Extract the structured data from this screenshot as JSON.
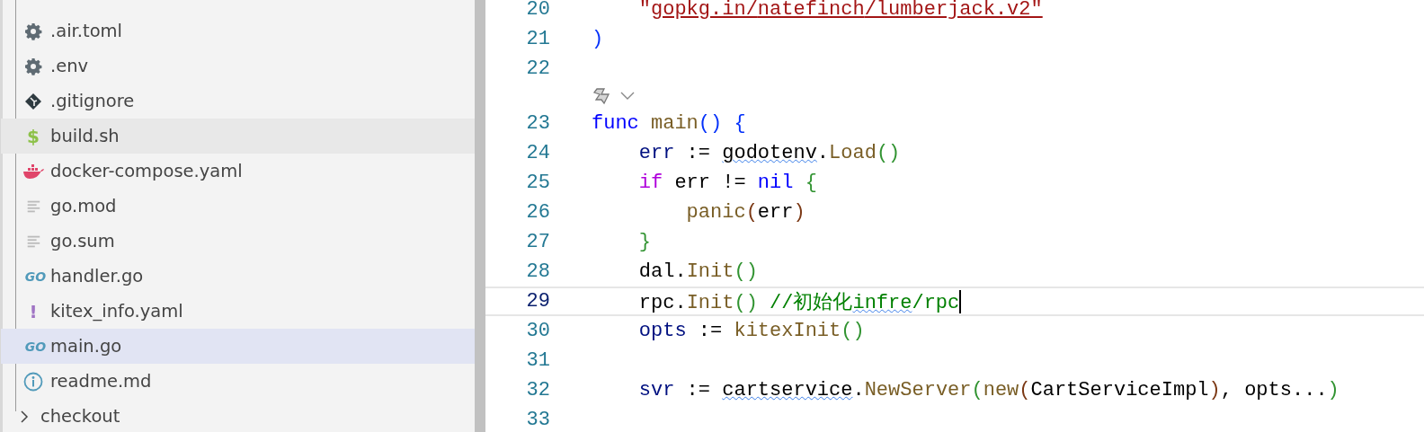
{
  "explorer": {
    "items": [
      {
        "kind": "gear",
        "name": ".air.toml",
        "selected": false,
        "hovered": false
      },
      {
        "kind": "gear",
        "name": ".env",
        "selected": false,
        "hovered": false
      },
      {
        "kind": "git",
        "name": ".gitignore",
        "selected": false,
        "hovered": false
      },
      {
        "kind": "shell",
        "glyph": "$",
        "name": "build.sh",
        "selected": false,
        "hovered": true
      },
      {
        "kind": "docker",
        "name": "docker-compose.yaml",
        "selected": false,
        "hovered": false
      },
      {
        "kind": "text",
        "name": "go.mod",
        "selected": false,
        "hovered": false
      },
      {
        "kind": "text",
        "name": "go.sum",
        "selected": false,
        "hovered": false
      },
      {
        "kind": "go",
        "glyph": "GO",
        "name": "handler.go",
        "selected": false,
        "hovered": false
      },
      {
        "kind": "yaml",
        "glyph": "!",
        "name": "kitex_info.yaml",
        "selected": false,
        "hovered": false
      },
      {
        "kind": "go",
        "glyph": "GO",
        "name": "main.go",
        "selected": true,
        "hovered": false
      },
      {
        "kind": "info",
        "name": "readme.md",
        "selected": false,
        "hovered": false
      },
      {
        "kind": "folder",
        "name": "checkout",
        "expanded": false,
        "selected": false,
        "hovered": false
      }
    ]
  },
  "editor": {
    "lines": [
      {
        "kind": "code",
        "number": "20",
        "current": false,
        "tokens": [
          {
            "text": "    \"",
            "kind": "str"
          },
          {
            "text": "gopkg.in/",
            "kind": "link"
          },
          {
            "text": "natefinch",
            "kind": "link-squiggle"
          },
          {
            "text": "/lumberjack.v2\"",
            "kind": "link"
          }
        ]
      },
      {
        "kind": "code",
        "number": "21",
        "current": false,
        "tokens": [
          {
            "text": ")",
            "kind": "b1"
          }
        ]
      },
      {
        "kind": "code",
        "number": "22",
        "current": false
      },
      {
        "kind": "lens"
      },
      {
        "kind": "code",
        "number": "23",
        "current": false,
        "tokens": [
          {
            "text": "func",
            "kind": "kw"
          },
          {
            "text": " main",
            "kind": "fn"
          },
          {
            "text": "()",
            "kind": "b1"
          },
          {
            "text": " {",
            "kind": "b1"
          }
        ]
      },
      {
        "kind": "code",
        "number": "24",
        "current": false,
        "tokens": [
          {
            "text": "    err",
            "kind": "var"
          },
          {
            "text": " := ",
            "kind": "op"
          },
          {
            "text": "godotenv",
            "kind": "op-squiggle"
          },
          {
            "text": ".",
            "kind": "op"
          },
          {
            "text": "Load",
            "kind": "fn"
          },
          {
            "text": "()",
            "kind": "b2"
          }
        ]
      },
      {
        "kind": "code",
        "number": "25",
        "current": false,
        "tokens": [
          {
            "text": "    if",
            "kind": "ctrl"
          },
          {
            "text": " err != ",
            "kind": "op"
          },
          {
            "text": "nil",
            "kind": "kw"
          },
          {
            "text": " {",
            "kind": "b2"
          }
        ]
      },
      {
        "kind": "code",
        "number": "26",
        "current": false,
        "tokens": [
          {
            "text": "        panic",
            "kind": "fn"
          },
          {
            "text": "(",
            "kind": "b3"
          },
          {
            "text": "err",
            "kind": "op"
          },
          {
            "text": ")",
            "kind": "b3"
          }
        ]
      },
      {
        "kind": "code",
        "number": "27",
        "current": false,
        "tokens": [
          {
            "text": "    }",
            "kind": "b2"
          }
        ]
      },
      {
        "kind": "code",
        "number": "28",
        "current": false,
        "tokens": [
          {
            "text": "    dal.",
            "kind": "op"
          },
          {
            "text": "Init",
            "kind": "fn"
          },
          {
            "text": "()",
            "kind": "b2"
          }
        ]
      },
      {
        "kind": "code",
        "number": "29",
        "current": true,
        "tokens": [
          {
            "text": "    rpc.",
            "kind": "op"
          },
          {
            "text": "Init",
            "kind": "fn"
          },
          {
            "text": "()",
            "kind": "b2"
          },
          {
            "text": " //初始化",
            "kind": "cm"
          },
          {
            "text": "infre",
            "kind": "cm-squiggle"
          },
          {
            "text": "/rpc",
            "kind": "cm"
          }
        ]
      },
      {
        "kind": "code",
        "number": "30",
        "current": false,
        "tokens": [
          {
            "text": "    opts",
            "kind": "var"
          },
          {
            "text": " := ",
            "kind": "op"
          },
          {
            "text": "kitexInit",
            "kind": "fn"
          },
          {
            "text": "()",
            "kind": "b2"
          }
        ]
      },
      {
        "kind": "code",
        "number": "31",
        "current": false
      },
      {
        "kind": "code",
        "number": "32",
        "current": false,
        "tokens": [
          {
            "text": "    svr",
            "kind": "var"
          },
          {
            "text": " := ",
            "kind": "op"
          },
          {
            "text": "cartservice",
            "kind": "op-squiggle"
          },
          {
            "text": ".",
            "kind": "op"
          },
          {
            "text": "NewServer",
            "kind": "fn"
          },
          {
            "text": "(",
            "kind": "b2"
          },
          {
            "text": "new",
            "kind": "fn"
          },
          {
            "text": "(",
            "kind": "b3"
          },
          {
            "text": "CartServiceImpl",
            "kind": "op"
          },
          {
            "text": ")",
            "kind": "b3"
          },
          {
            "text": ", opts...",
            "kind": "op"
          },
          {
            "text": ")",
            "kind": "b2"
          }
        ]
      },
      {
        "kind": "code",
        "number": "33",
        "current": false
      }
    ]
  }
}
